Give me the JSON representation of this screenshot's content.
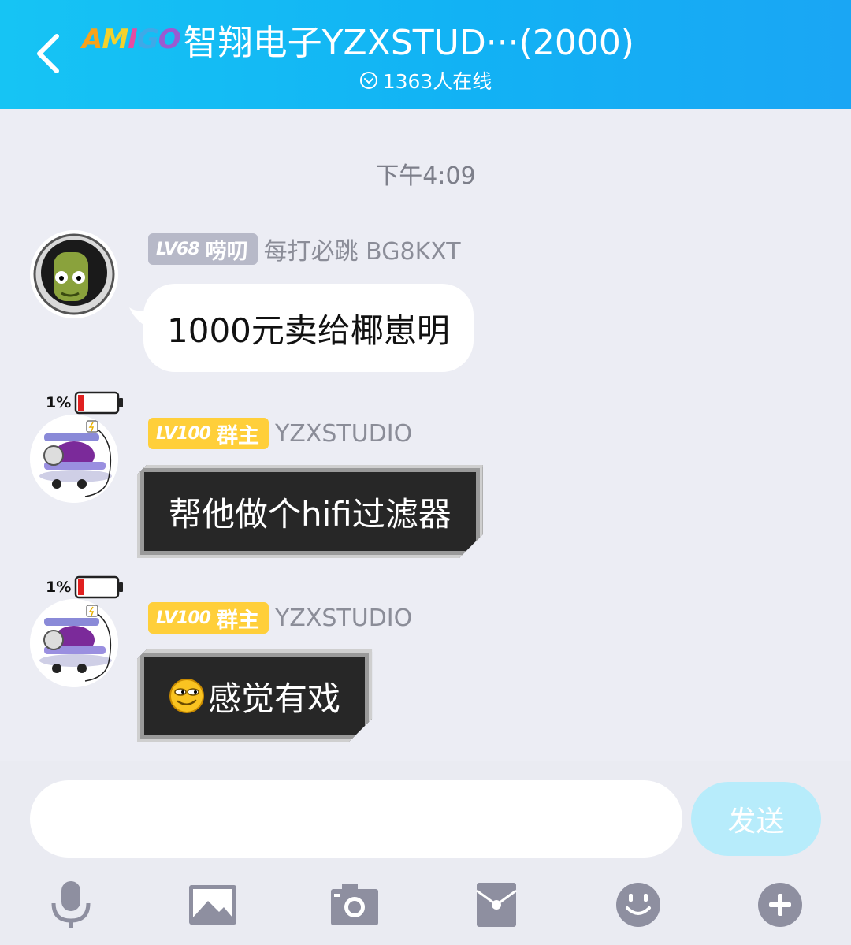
{
  "header": {
    "logo_text": [
      "A",
      "M",
      "I",
      "G",
      "O"
    ],
    "title": "智翔电子YZXSTUD···(2000)",
    "online": "1363人在线"
  },
  "timestamp": "下午4:09",
  "messages": [
    {
      "level": "LV68",
      "title_badge": "唠叨",
      "sender": "每打必跳 BG8KXT",
      "text": "1000元卖给椰崽明"
    },
    {
      "battery": "1%",
      "level": "LV100",
      "title_badge": "群主",
      "sender": "YZXSTUDIO",
      "text": "帮他做个hifi过滤器"
    },
    {
      "battery": "1%",
      "level": "LV100",
      "title_badge": "群主",
      "sender": "YZXSTUDIO",
      "text": "感觉有戏"
    }
  ],
  "input": {
    "placeholder": "",
    "send_label": "发送"
  },
  "toolbar": [
    "microphone-icon",
    "image-icon",
    "camera-icon",
    "red-packet-icon",
    "emoji-icon",
    "plus-icon"
  ],
  "colors": {
    "header": "#16c4f4",
    "badge_gold": "#ffcf3a",
    "badge_gray": "#b7b9c8",
    "send": "#b7ecfb",
    "toolbar_icon": "#8e8fa0"
  }
}
